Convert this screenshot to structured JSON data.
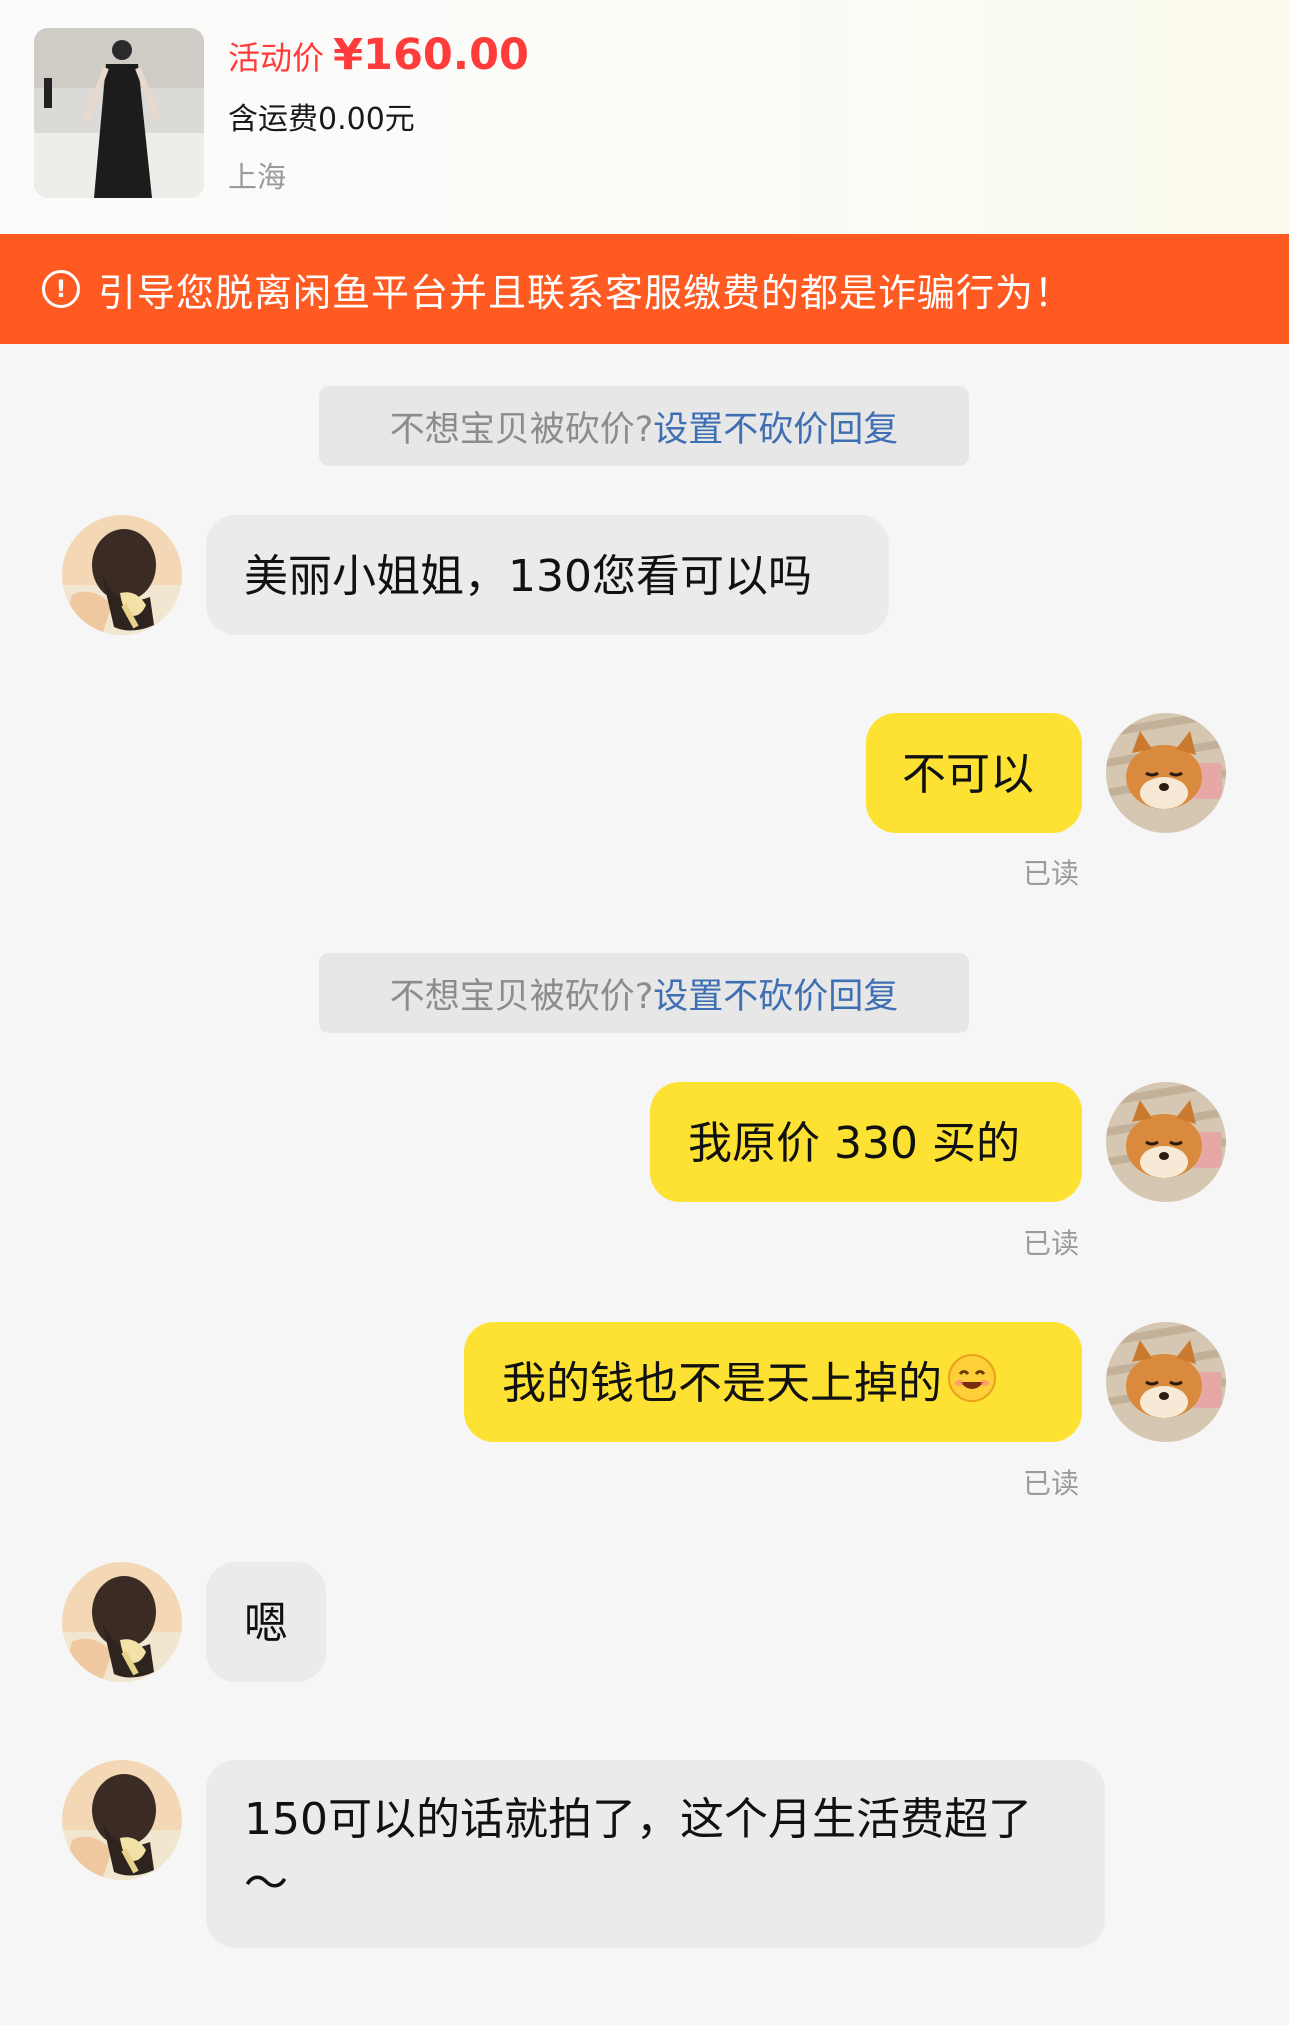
{
  "product": {
    "price_label": "活动价",
    "price_value": "¥160.00",
    "shipping": "含运费0.00元",
    "location": "上海",
    "thumb_icon": "dress-photo"
  },
  "warning": {
    "icon": "alert-circle-icon",
    "text": "引导您脱离闲鱼平台并且联系客服缴费的都是诈骗行为！"
  },
  "tip": {
    "text": "不想宝贝被砍价?",
    "link": "设置不砍价回复"
  },
  "messages": [
    {
      "from": "buyer",
      "text": "美丽小姐姐，130您看可以吗"
    },
    {
      "from": "seller",
      "text": "不可以",
      "status": "已读"
    },
    {
      "from": "seller",
      "text": "我原价 330 买的",
      "status": "已读"
    },
    {
      "from": "seller",
      "text": "我的钱也不是天上掉的",
      "emoji": "smiling-face-emoji",
      "status": "已读"
    },
    {
      "from": "buyer",
      "text": "嗯"
    },
    {
      "from": "buyer",
      "text": "150可以的话就拍了，这个月生活费超了～"
    }
  ],
  "colors": {
    "accent": "#ff3b3b",
    "warning_bg": "#ff5a22",
    "outgoing_bubble": "#fde233",
    "incoming_bubble": "#ebebeb",
    "link": "#3f6fb3"
  }
}
